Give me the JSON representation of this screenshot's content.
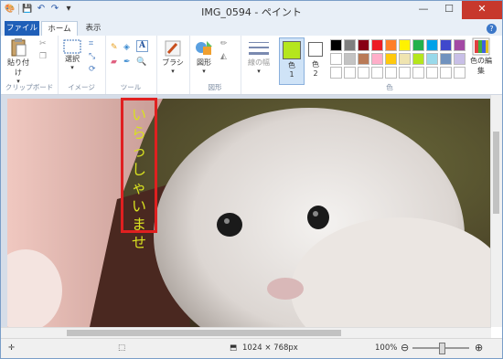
{
  "window": {
    "title": "IMG_0594 - ペイント",
    "minimize": "—",
    "maximize": "☐",
    "close": "✕"
  },
  "qat": {
    "paint_icon": "🎨",
    "save": "💾",
    "undo": "↶",
    "redo": "↷",
    "dropdown": "▾"
  },
  "tabs": {
    "file": "ファイル",
    "home": "ホーム",
    "view": "表示",
    "help": "?"
  },
  "ribbon": {
    "clipboard": {
      "paste": "貼り付け",
      "label": "クリップボード"
    },
    "image": {
      "select": "選択",
      "label": "イメージ"
    },
    "tools": {
      "label": "ツール"
    },
    "brushes": {
      "label": "ブラシ"
    },
    "shapes": {
      "shapes_btn": "図形",
      "label": "図形"
    },
    "size": {
      "label": "線の幅"
    },
    "colors": {
      "color1": "色",
      "color1_num": "1",
      "color2": "色",
      "color2_num": "2",
      "edit": "色の編集",
      "label": "色"
    }
  },
  "palette": [
    "#000000",
    "#7f7f7f",
    "#880015",
    "#ed1c24",
    "#ff7f27",
    "#fff200",
    "#22b14c",
    "#00a2e8",
    "#3f48cc",
    "#a349a4",
    "#ffffff",
    "#c3c3c3",
    "#b97a57",
    "#ffaec9",
    "#ffc90e",
    "#efe4b0",
    "#b5e61d",
    "#99d9ea",
    "#7092be",
    "#c8bfe7",
    "#ffffff",
    "#ffffff",
    "#ffffff",
    "#ffffff",
    "#ffffff",
    "#ffffff",
    "#ffffff",
    "#ffffff",
    "#ffffff",
    "#ffffff"
  ],
  "colors_state": {
    "color1": "#b5e61d",
    "color2": "#ffffff"
  },
  "canvas": {
    "vertical_text": "いらっしゃいませ"
  },
  "status": {
    "dimensions": "1024 × 768px",
    "zoom": "100%",
    "zoom_out": "⊖",
    "zoom_in": "⊕"
  }
}
